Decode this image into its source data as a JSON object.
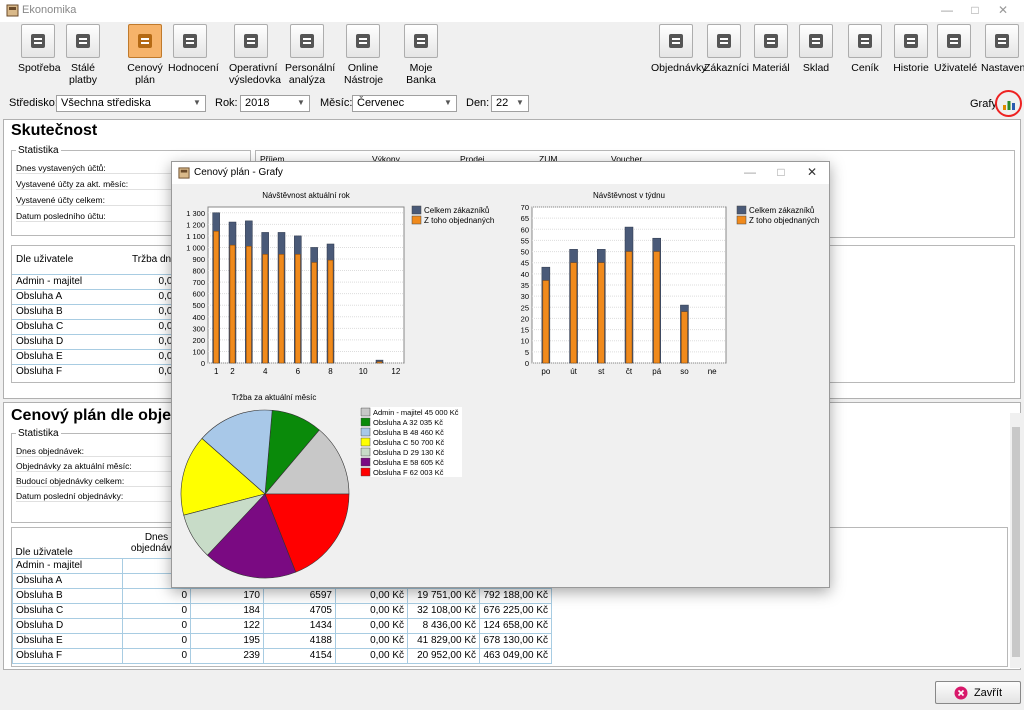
{
  "window": {
    "title": "Ekonomika"
  },
  "toolbar": {
    "left": [
      {
        "label": "Spotřeba",
        "icon": "consumption-icon"
      },
      {
        "label": "Stálé\nplatby",
        "icon": "fixed-payments-icon"
      },
      {
        "label": "Cenový\nplán",
        "icon": "bar-chart-icon",
        "active": true
      },
      {
        "label": "Hodnocení",
        "icon": "rating-icon"
      },
      {
        "label": "Operativní\nvýsledovka",
        "icon": "presentation-icon"
      },
      {
        "label": "Personální\nanalýza",
        "icon": "pie-icon"
      },
      {
        "label": "Online\nNástroje",
        "icon": "menu-icon"
      },
      {
        "label": "Moje\nBanka",
        "icon": "bank-icon"
      }
    ],
    "right": [
      {
        "label": "Objednávky",
        "icon": "orders-icon"
      },
      {
        "label": "Zákazníci",
        "icon": "customers-icon"
      },
      {
        "label": "Materiál",
        "icon": "material-icon"
      },
      {
        "label": "Sklad",
        "icon": "warehouse-icon"
      },
      {
        "label": "Ceník",
        "icon": "pricelist-icon"
      },
      {
        "label": "Historie",
        "icon": "history-icon"
      },
      {
        "label": "Uživatelé",
        "icon": "users-icon"
      },
      {
        "label": "Nastavení",
        "icon": "settings-icon"
      }
    ]
  },
  "filters": {
    "stredisko_label": "Středisko:",
    "stredisko_value": "Všechna střediska",
    "rok_label": "Rok:",
    "rok_value": "2018",
    "mesic_label": "Měsíc:",
    "mesic_value": "Červenec",
    "den_label": "Den:",
    "den_value": "22",
    "grafy_label": "Grafy"
  },
  "skutecnost": {
    "title": "Skutečnost",
    "stat_title": "Statistika",
    "stats": [
      "Dnes vystavených účtů:",
      "Vystavené účty za akt. měsíc:",
      "Vystavené účty celkem:",
      "Datum posledního účtu:"
    ],
    "cols": [
      "Příjem",
      "Výkony",
      "Prodej",
      "ZUM",
      "Voucher"
    ],
    "user_header": "Dle uživatele",
    "trzba_header": "Tržba dne",
    "users": [
      {
        "name": "Admin - majitel",
        "val": "0,00"
      },
      {
        "name": "Obsluha A",
        "val": "0,00"
      },
      {
        "name": "Obsluha B",
        "val": "0,00"
      },
      {
        "name": "Obsluha C",
        "val": "0,00"
      },
      {
        "name": "Obsluha D",
        "val": "0,00"
      },
      {
        "name": "Obsluha E",
        "val": "0,00"
      },
      {
        "name": "Obsluha F",
        "val": "0,00"
      }
    ]
  },
  "cenovy": {
    "title": "Cenový plán dle objed",
    "stat_title": "Statistika",
    "stats": [
      "Dnes objednávek:",
      "Objednávky za aktuální měsíc:",
      "Budoucí objednávky celkem:",
      "Datum poslední objednávky:"
    ],
    "user_header": "Dle uživatele",
    "dnes_header": "Dnes\nobjednávek",
    "rows": [
      {
        "name": "Admin - majitel",
        "c1": "",
        "c2": "",
        "c3": "",
        "c4": "",
        "c5": "",
        "c6": ""
      },
      {
        "name": "Obsluha A",
        "c1": "",
        "c2": "",
        "c3": "",
        "c4": "",
        "c5": "",
        "c6": ""
      },
      {
        "name": "Obsluha B",
        "c1": "0",
        "c2": "170",
        "c3": "6597",
        "c4": "0,00 Kč",
        "c5": "19 751,00 Kč",
        "c6": "792 188,00 Kč"
      },
      {
        "name": "Obsluha C",
        "c1": "0",
        "c2": "184",
        "c3": "4705",
        "c4": "0,00 Kč",
        "c5": "32 108,00 Kč",
        "c6": "676 225,00 Kč"
      },
      {
        "name": "Obsluha D",
        "c1": "0",
        "c2": "122",
        "c3": "1434",
        "c4": "0,00 Kč",
        "c5": "8 436,00 Kč",
        "c6": "124 658,00 Kč"
      },
      {
        "name": "Obsluha E",
        "c1": "0",
        "c2": "195",
        "c3": "4188",
        "c4": "0,00 Kč",
        "c5": "41 829,00 Kč",
        "c6": "678 130,00 Kč"
      },
      {
        "name": "Obsluha F",
        "c1": "0",
        "c2": "239",
        "c3": "4154",
        "c4": "0,00 Kč",
        "c5": "20 952,00 Kč",
        "c6": "463 049,00 Kč"
      }
    ]
  },
  "dialog": {
    "title": "Cenový plán - Grafy"
  },
  "close_label": "Zavřít",
  "chart_data": [
    {
      "type": "bar",
      "title": "Návštěvnost aktuální rok",
      "x": [
        1,
        2,
        3,
        4,
        5,
        6,
        7,
        8,
        9,
        10,
        11,
        12
      ],
      "xticks": [
        "1",
        "2",
        "4",
        "6",
        "8",
        "10",
        "12"
      ],
      "series": [
        {
          "name": "Celkem zákazníků",
          "color": "#4a5a78",
          "values": [
            1300,
            1220,
            1230,
            1130,
            1130,
            1100,
            1000,
            1030,
            0,
            0,
            25,
            0
          ]
        },
        {
          "name": "Z toho objednaných",
          "color": "#f08a1c",
          "values": [
            1140,
            1020,
            1010,
            940,
            940,
            940,
            870,
            890,
            0,
            0,
            10,
            0
          ]
        }
      ],
      "yticks": [
        "1 300",
        "1 200",
        "1 100",
        "1 000",
        "900",
        "800",
        "700",
        "600",
        "500",
        "400",
        "300",
        "200",
        "100",
        "0"
      ],
      "ylim": [
        0,
        1350
      ]
    },
    {
      "type": "bar",
      "title": "Návštěvnost v týdnu",
      "categories": [
        "po",
        "út",
        "st",
        "čt",
        "pá",
        "so",
        "ne"
      ],
      "series": [
        {
          "name": "Celkem zákazníků",
          "color": "#4a5a78",
          "values": [
            43,
            51,
            51,
            61,
            56,
            26,
            0
          ]
        },
        {
          "name": "Z toho objednaných",
          "color": "#f08a1c",
          "values": [
            37,
            45,
            45,
            50,
            50,
            23,
            0
          ]
        }
      ],
      "yticks": [
        "70",
        "65",
        "60",
        "55",
        "50",
        "45",
        "40",
        "35",
        "30",
        "25",
        "20",
        "15",
        "10",
        "5",
        "0"
      ],
      "ylim": [
        0,
        70
      ]
    },
    {
      "type": "pie",
      "title": "Tržba za aktuální měsíc",
      "slices": [
        {
          "label": "Admin - majitel 45 000 Kč",
          "value": 45000,
          "color": "#c8c8c8"
        },
        {
          "label": "Obsluha A 32 035 Kč",
          "value": 32035,
          "color": "#0a8a0a"
        },
        {
          "label": "Obsluha B 48 460 Kč",
          "value": 48460,
          "color": "#a8c8e8"
        },
        {
          "label": "Obsluha C 50 700 Kč",
          "value": 50700,
          "color": "#ffff00"
        },
        {
          "label": "Obsluha D 29 130 Kč",
          "value": 29130,
          "color": "#c8dcc8"
        },
        {
          "label": "Obsluha E 58 605 Kč",
          "value": 58605,
          "color": "#7a0a82"
        },
        {
          "label": "Obsluha F 62 003 Kč",
          "value": 62003,
          "color": "#ff0000"
        }
      ]
    }
  ]
}
